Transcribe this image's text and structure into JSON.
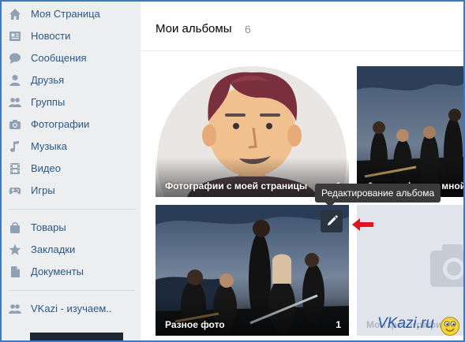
{
  "sidebar": {
    "items": [
      {
        "label": "Моя Страница",
        "icon": "home-icon"
      },
      {
        "label": "Новости",
        "icon": "news-icon"
      },
      {
        "label": "Сообщения",
        "icon": "messages-icon"
      },
      {
        "label": "Друзья",
        "icon": "friends-icon"
      },
      {
        "label": "Группы",
        "icon": "groups-icon"
      },
      {
        "label": "Фотографии",
        "icon": "camera-icon"
      },
      {
        "label": "Музыка",
        "icon": "music-icon"
      },
      {
        "label": "Видео",
        "icon": "video-icon"
      },
      {
        "label": "Игры",
        "icon": "games-icon"
      },
      {
        "label": "Товары",
        "icon": "bag-icon"
      },
      {
        "label": "Закладки",
        "icon": "star-icon"
      },
      {
        "label": "Документы",
        "icon": "document-icon"
      },
      {
        "label": "VKazi - изучаем..",
        "icon": "community-icon"
      }
    ]
  },
  "main": {
    "title": "Мои альбомы",
    "count": "6",
    "albums": [
      {
        "caption": "Фотографии с моей страницы",
        "count": "1"
      },
      {
        "caption": "Фотографии со мной"
      },
      {
        "caption": "Разное фото",
        "count": "1"
      },
      {
        "caption": "Мои фотографии"
      }
    ],
    "tooltip": "Редактирование альбома"
  },
  "watermark": "VKazi.ru",
  "colors": {
    "link": "#2a5885",
    "sidebar_bg": "#edeef0",
    "frame_border": "#3f77c0",
    "arrow": "#e0161e"
  }
}
